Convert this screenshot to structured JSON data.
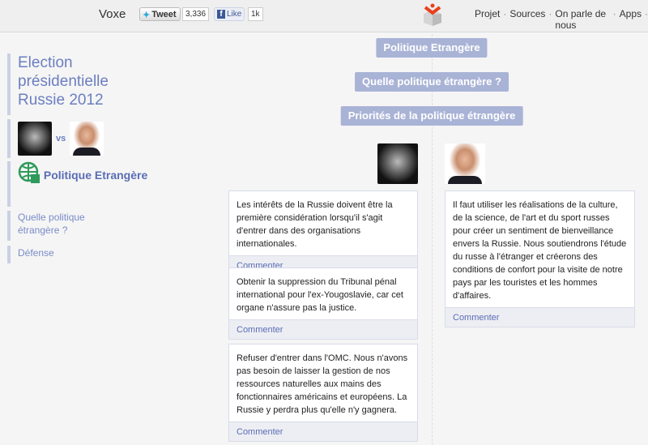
{
  "header": {
    "brand": "Voxe",
    "tweet_label": "Tweet",
    "tweet_count": "3,336",
    "like_label": "Like",
    "like_count": "1k",
    "nav": [
      "Projet",
      "Sources",
      "On parle de nous",
      "Apps"
    ]
  },
  "sidebar": {
    "title": "Election présidentielle Russie 2012",
    "vs": "vs",
    "category": "Politique Etrangère",
    "items": [
      "Quelle politique étrangère ?",
      "Défense"
    ]
  },
  "main": {
    "pills": [
      "Politique Etrangère",
      "Quelle politique étrangère ?",
      "Priorités de la politique étrangère"
    ],
    "comment_label": "Commenter",
    "left_proposals": [
      "Les intérêts de la Russie doivent être la première considération lorsqu'il s'agit d'entrer dans des organisations internationales.",
      "Obtenir la suppression du Tribunal pénal international pour l'ex-Yougoslavie, car cet organe n'assure pas la justice.",
      "Refuser d'entrer dans l'OMC. Nous n'avons pas besoin de laisser la gestion de nos ressources naturelles aux mains des fonctionnaires américains et européens. La Russie y perdra plus qu'elle n'y gagnera."
    ],
    "right_proposals": [
      "Il faut utiliser les réalisations de la culture, de la science, de l'art et du sport russes pour créer un sentiment de bienveillance envers la Russie. Nous soutiendrons l'étude du russe à l'étranger et créerons des conditions de confort pour la visite de notre pays par les touristes et les hommes d'affaires."
    ]
  },
  "colors": {
    "accent": "#6b7ec0",
    "pill": "#a9b3d6",
    "logo": "#e8401c",
    "icon": "#2e9a5c"
  }
}
